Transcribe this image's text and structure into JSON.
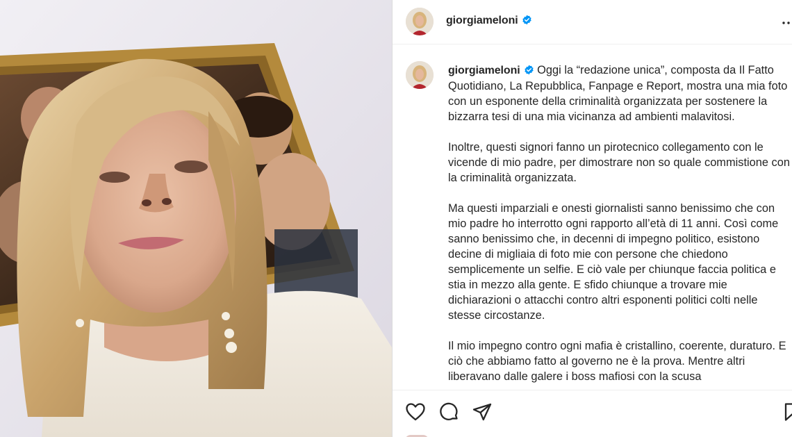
{
  "post": {
    "username": "giorgiameloni",
    "verified": true,
    "photo_alt": "selfie"
  },
  "caption": {
    "username": "giorgiameloni",
    "paragraphs": [
      "Oggi la “redazione unica”, composta da Il Fatto Quotidiano, La Repubblica, Fanpage e Report, mostra una mia foto con un esponente della criminalità organizzata per sostenere la bizzarra tesi di una mia vicinanza ad ambienti malavitosi.",
      "Inoltre, questi signori fanno un pirotecnico collegamento con le vicende di mio padre, per dimostrare non so quale commistione con la criminalità organizzata.",
      "Ma questi imparziali e onesti giornalisti sanno benissimo che con mio padre ho interrotto ogni rapporto all’età di 11 anni. Così come sanno benissimo che, in decenni di impegno politico, esistono decine di migliaia di foto mie con persone che chiedono semplicemente un selfie. E ciò vale per chiunque faccia politica e stia in mezzo alla gente. E sfido chiunque a trovare mie dichiarazioni o attacchi contro altri esponenti politici colti nelle stesse circostanze.",
      "Il mio impegno contro ogni mafia è cristallino, coerente, duraturo. E ciò che abbiamo fatto al governo ne è la prova. Mentre altri liberavano dalle galere i boss mafiosi con la scusa"
    ]
  },
  "actions": {
    "like": "heart-icon",
    "comment": "comment-icon",
    "share": "share-icon",
    "save": "bookmark-icon"
  },
  "colors": {
    "text": "#262626",
    "verified": "#0095f6",
    "divider": "#dbdbdb"
  }
}
